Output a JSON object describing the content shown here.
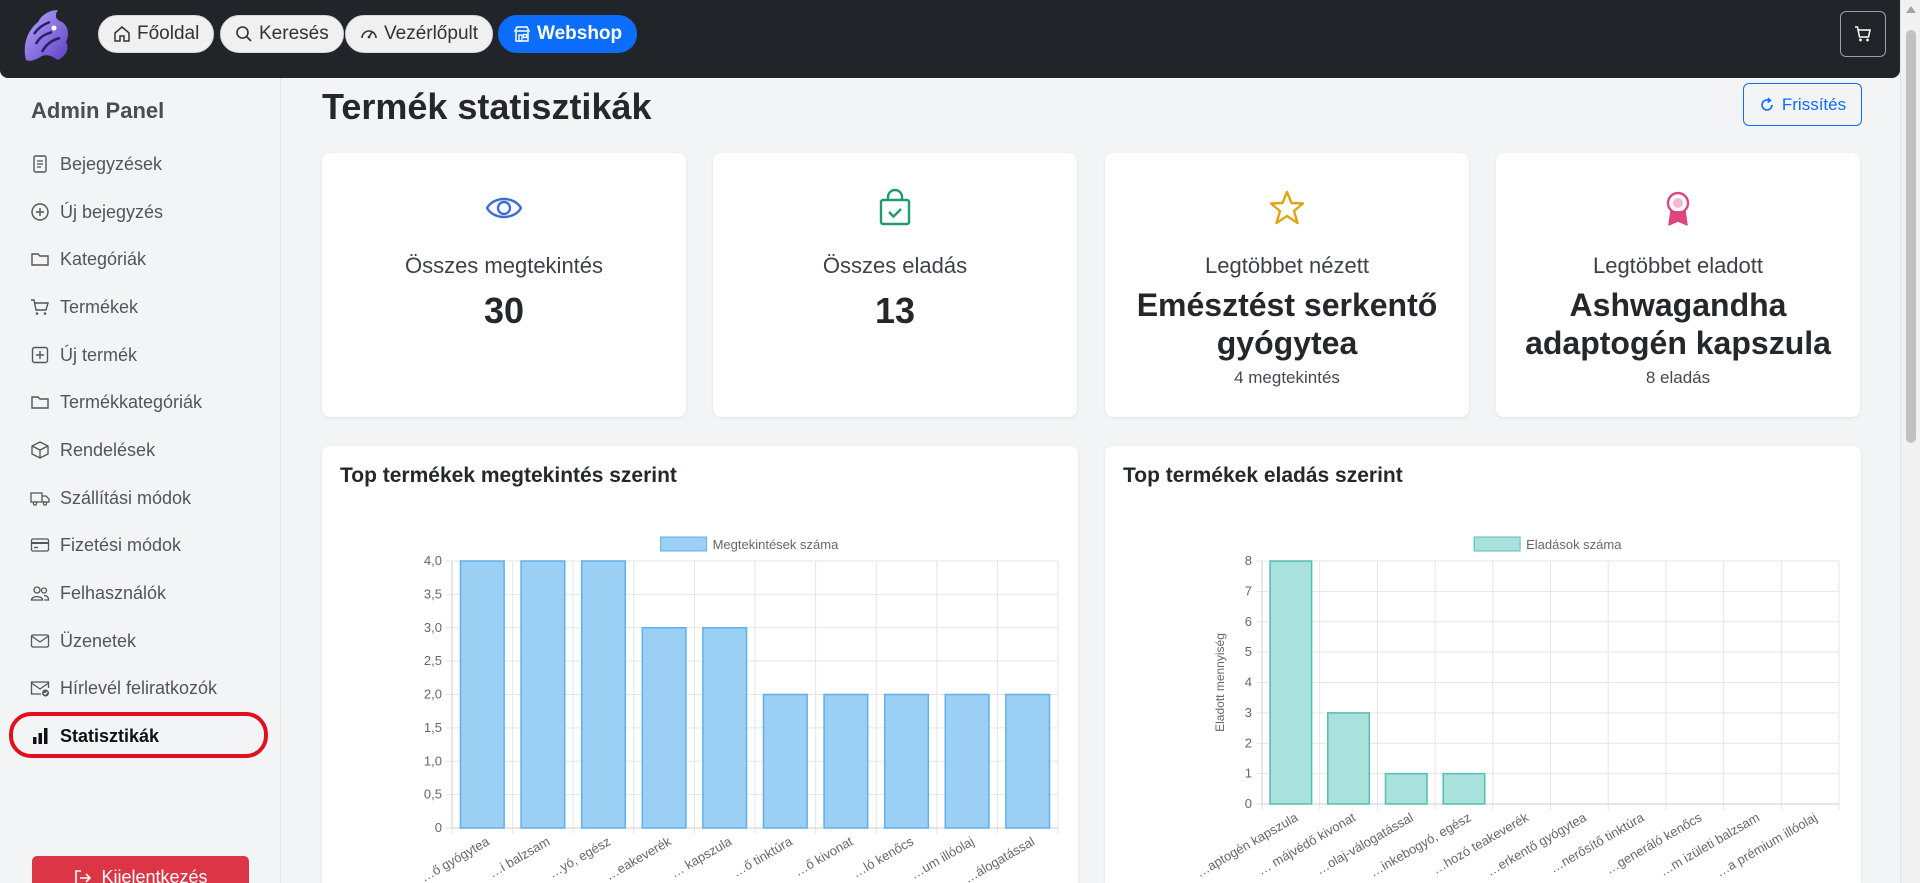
{
  "nav": {
    "home": "Főoldal",
    "search": "Keresés",
    "dashboard": "Vezérlőpult",
    "webshop": "Webshop"
  },
  "sidebar": {
    "title": "Admin Panel",
    "items": [
      {
        "label": "Bejegyzések",
        "icon": "document-icon"
      },
      {
        "label": "Új bejegyzés",
        "icon": "plus-circle-icon"
      },
      {
        "label": "Kategóriák",
        "icon": "folder-icon"
      },
      {
        "label": "Termékek",
        "icon": "cart-icon"
      },
      {
        "label": "Új termék",
        "icon": "plus-square-icon"
      },
      {
        "label": "Termékkategóriák",
        "icon": "folder-icon"
      },
      {
        "label": "Rendelések",
        "icon": "box-icon"
      },
      {
        "label": "Szállítási módok",
        "icon": "truck-icon"
      },
      {
        "label": "Fizetési módok",
        "icon": "credit-card-icon"
      },
      {
        "label": "Felhasználók",
        "icon": "users-icon"
      },
      {
        "label": "Üzenetek",
        "icon": "envelope-icon"
      },
      {
        "label": "Hírlevél feliratkozók",
        "icon": "envelope-check-icon"
      },
      {
        "label": "Statisztikák",
        "icon": "bar-chart-icon"
      }
    ],
    "logout": "Kijelentkezés"
  },
  "page": {
    "title": "Termék statisztikák",
    "refresh": "Frissítés"
  },
  "stats": {
    "views": {
      "label": "Összes megtekintés",
      "value": "30"
    },
    "sales": {
      "label": "Összes eladás",
      "value": "13"
    },
    "most_viewed": {
      "label": "Legtöbbet nézett",
      "name_line1": "Emésztést serkentő",
      "name_line2": "gyógytea",
      "sub": "4 megtekintés"
    },
    "most_sold": {
      "label": "Legtöbbet eladott",
      "name_line1": "Ashwagandha",
      "name_line2": "adaptogén kapszula",
      "sub": "8 eladás"
    }
  },
  "colors": {
    "primary": "#0d6efd",
    "danger": "#dc3545",
    "views_bar": "#9ccff4",
    "views_border": "#5fb0ea",
    "sales_bar": "#a9e2dc",
    "sales_border": "#55bdb2",
    "eye_icon": "#3d6fd1",
    "bag_icon": "#219b6e",
    "star_icon": "#e0a417",
    "award_icon": "#e0447f"
  },
  "chart_data": [
    {
      "type": "bar",
      "title": "Top termékek megtekintés szerint",
      "legend": "Megtekintések száma",
      "legend_position": "top",
      "ylim": [
        0,
        4
      ],
      "yticks": [
        "0",
        "0,5",
        "1,0",
        "1,5",
        "2,0",
        "2,5",
        "3,0",
        "3,5",
        "4,0"
      ],
      "categories": [
        "…ő gyógytea",
        "…i balzsam",
        "…yó, egész",
        "…eakeverék",
        "… kapszula",
        "…ő tinktúra",
        "…ő kivonat",
        "…ló kenőcs",
        "…um illóolaj",
        "…álogatással"
      ],
      "values": [
        4,
        4,
        4,
        3,
        3,
        2,
        2,
        2,
        2,
        2
      ],
      "grid": true
    },
    {
      "type": "bar",
      "title": "Top termékek eladás szerint",
      "legend": "Eladások száma",
      "legend_position": "top",
      "ylabel": "Eladott mennyiség",
      "ylim": [
        0,
        8
      ],
      "yticks": [
        "0",
        "1",
        "2",
        "3",
        "4",
        "5",
        "6",
        "7",
        "8"
      ],
      "categories": [
        "…aptogén kapszula",
        "… májvédő kivonat",
        "…olaj-válogatással",
        "…inkebogyó, egész",
        "…hozó teakeverék",
        "…erkentő gyógytea",
        "…nerősítő tinktúra",
        "…generáló kenőcs",
        "…m izületi balzsam",
        "…a prémium illóolaj"
      ],
      "values": [
        8,
        3,
        1,
        1,
        0,
        0,
        0,
        0,
        0,
        0
      ],
      "grid": true
    }
  ]
}
